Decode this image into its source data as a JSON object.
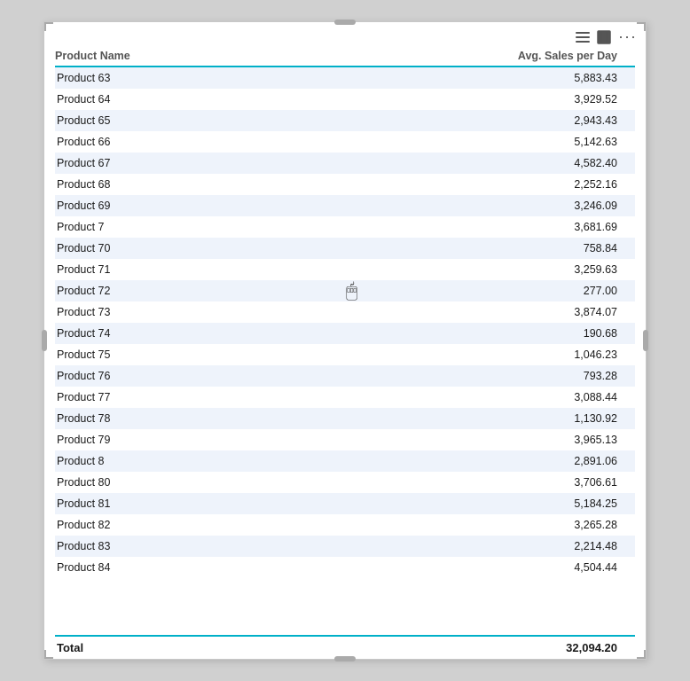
{
  "toolbar": {
    "hamburger_label": "≡",
    "expand_label": "⤢",
    "more_label": "···"
  },
  "table": {
    "col_product": "Product Name",
    "col_sales": "Avg. Sales per Day",
    "rows": [
      {
        "product": "Product 63",
        "sales": "5,883.43"
      },
      {
        "product": "Product 64",
        "sales": "3,929.52"
      },
      {
        "product": "Product 65",
        "sales": "2,943.43"
      },
      {
        "product": "Product 66",
        "sales": "5,142.63"
      },
      {
        "product": "Product 67",
        "sales": "4,582.40"
      },
      {
        "product": "Product 68",
        "sales": "2,252.16"
      },
      {
        "product": "Product 69",
        "sales": "3,246.09"
      },
      {
        "product": "Product 7",
        "sales": "3,681.69"
      },
      {
        "product": "Product 70",
        "sales": "758.84"
      },
      {
        "product": "Product 71",
        "sales": "3,259.63"
      },
      {
        "product": "Product 72",
        "sales": "277.00"
      },
      {
        "product": "Product 73",
        "sales": "3,874.07"
      },
      {
        "product": "Product 74",
        "sales": "190.68"
      },
      {
        "product": "Product 75",
        "sales": "1,046.23"
      },
      {
        "product": "Product 76",
        "sales": "793.28"
      },
      {
        "product": "Product 77",
        "sales": "3,088.44"
      },
      {
        "product": "Product 78",
        "sales": "1,130.92"
      },
      {
        "product": "Product 79",
        "sales": "3,965.13"
      },
      {
        "product": "Product 8",
        "sales": "2,891.06"
      },
      {
        "product": "Product 80",
        "sales": "3,706.61"
      },
      {
        "product": "Product 81",
        "sales": "5,184.25"
      },
      {
        "product": "Product 82",
        "sales": "3,265.28"
      },
      {
        "product": "Product 83",
        "sales": "2,214.48"
      },
      {
        "product": "Product 84",
        "sales": "4,504.44"
      }
    ],
    "total_label": "Total",
    "total_value": "32,094.20"
  }
}
